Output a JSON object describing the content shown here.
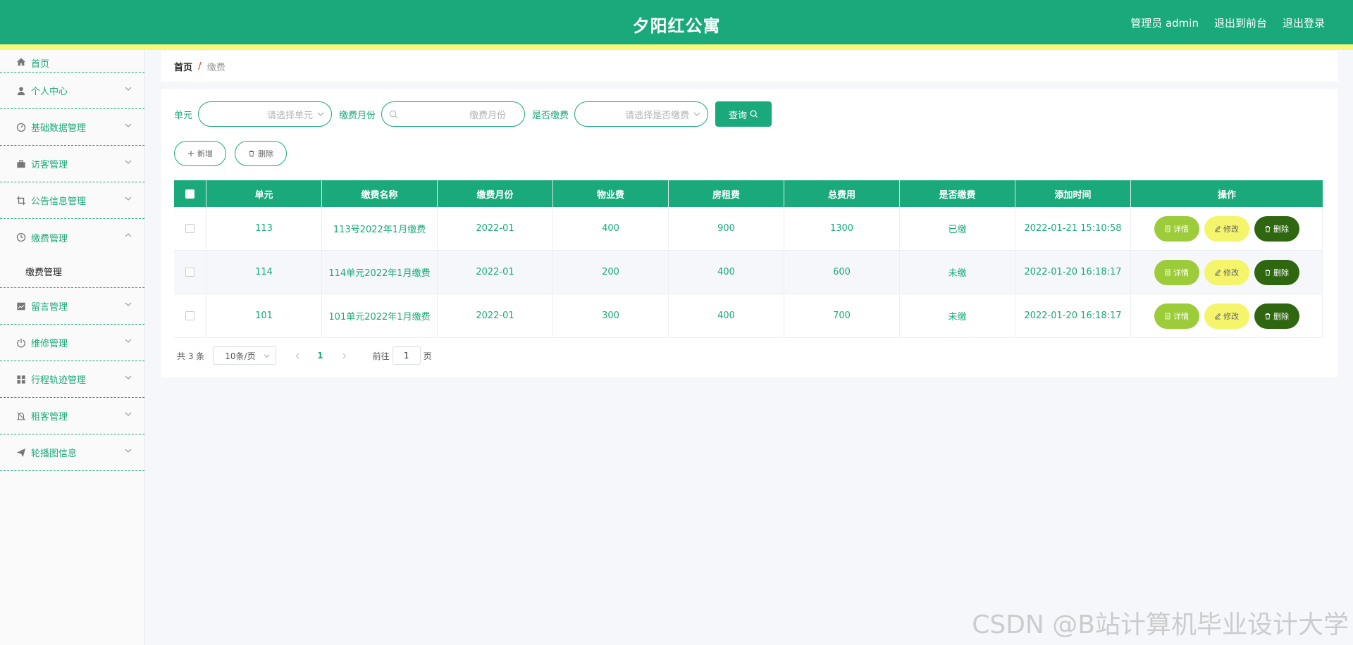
{
  "header": {
    "title": "夕阳红公寓",
    "links": [
      "管理员 admin",
      "退出到前台",
      "退出登录"
    ]
  },
  "sidebar": {
    "items": [
      {
        "label": "首页",
        "icon": "home-icon"
      },
      {
        "label": "个人中心",
        "icon": "user-icon"
      },
      {
        "label": "基础数据管理",
        "icon": "dashboard-icon"
      },
      {
        "label": "访客管理",
        "icon": "briefcase-icon"
      },
      {
        "label": "公告信息管理",
        "icon": "crop-icon"
      },
      {
        "label": "缴费管理",
        "icon": "clock-icon"
      },
      {
        "label": "留言管理",
        "icon": "chart-icon"
      },
      {
        "label": "维修管理",
        "icon": "power-icon"
      },
      {
        "label": "行程轨迹管理",
        "icon": "grid-icon"
      },
      {
        "label": "租客管理",
        "icon": "bell-off-icon"
      },
      {
        "label": "轮播图信息",
        "icon": "send-icon"
      }
    ],
    "submenu": {
      "label": "缴费管理"
    }
  },
  "breadcrumb": {
    "home": "首页",
    "separator": "/",
    "current": "缴费"
  },
  "filters": {
    "unit_label": "单元",
    "unit_placeholder": "请选择单元",
    "month_label": "缴费月份",
    "month_placeholder": "缴费月份",
    "paid_label": "是否缴费",
    "paid_placeholder": "请选择是否缴费",
    "query_label": "查询"
  },
  "actions": {
    "add_label": "新增",
    "delete_label": "删除"
  },
  "table": {
    "columns": [
      "单元",
      "缴费名称",
      "缴费月份",
      "物业费",
      "房租费",
      "总费用",
      "是否缴费",
      "添加时间",
      "操作"
    ],
    "rows": [
      {
        "unit": "113",
        "name": "113号2022年1月缴费",
        "month": "2022-01",
        "property_fee": "400",
        "rent": "900",
        "total": "1300",
        "paid": "已缴",
        "added": "2022-01-21 15:10:58"
      },
      {
        "unit": "114",
        "name": "114单元2022年1月缴费",
        "month": "2022-01",
        "property_fee": "200",
        "rent": "400",
        "total": "600",
        "paid": "未缴",
        "added": "2022-01-20 16:18:17"
      },
      {
        "unit": "101",
        "name": "101单元2022年1月缴费",
        "month": "2022-01",
        "property_fee": "300",
        "rent": "400",
        "total": "700",
        "paid": "未缴",
        "added": "2022-01-20 16:18:17"
      }
    ],
    "ops": {
      "detail": "详情",
      "edit": "修改",
      "delete": "删除"
    }
  },
  "pagination": {
    "total_text": "共 3 条",
    "page_size": "10条/页",
    "current_page": "1",
    "goto_label": "前往",
    "goto_value": "1",
    "page_suffix": "页"
  },
  "watermark": "CSDN @B站计算机毕业设计大学",
  "colors": {
    "primary": "#1aa97b",
    "accent_strip": "#f7f77a",
    "detail": "#9ccc3a",
    "edit": "#f4f56b",
    "delete": "#2f6610"
  }
}
